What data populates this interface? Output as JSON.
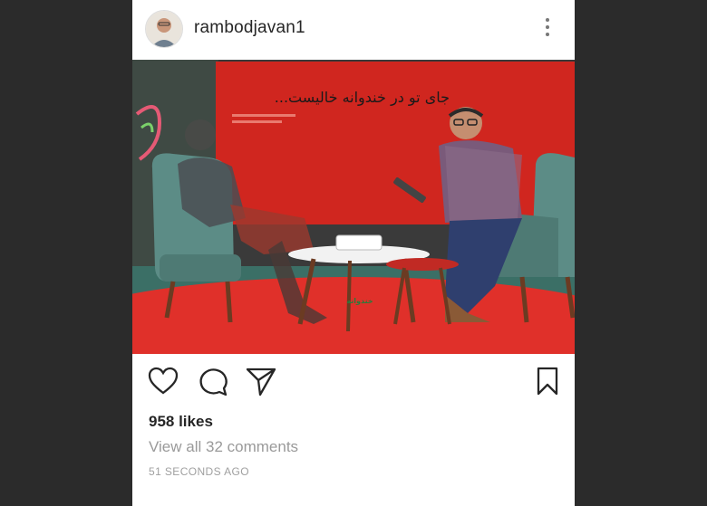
{
  "post": {
    "username": "rambodjavan1",
    "photo": {
      "headline": "جای تو در خندوانه خالیست...",
      "logo_text": "خندوانه"
    },
    "icons": {
      "more": "more-vertical-icon",
      "like": "heart-icon",
      "comment": "comment-icon",
      "share": "send-icon",
      "save": "bookmark-icon"
    },
    "likes": "958 likes",
    "comments_link": "View all 32 comments",
    "timestamp": "51 SECONDS AGO"
  },
  "colors": {
    "background": "#2b2b2b",
    "card": "#ffffff",
    "studio_red": "#d22a22",
    "text_primary": "#262626",
    "text_secondary": "#9a9a9a"
  }
}
